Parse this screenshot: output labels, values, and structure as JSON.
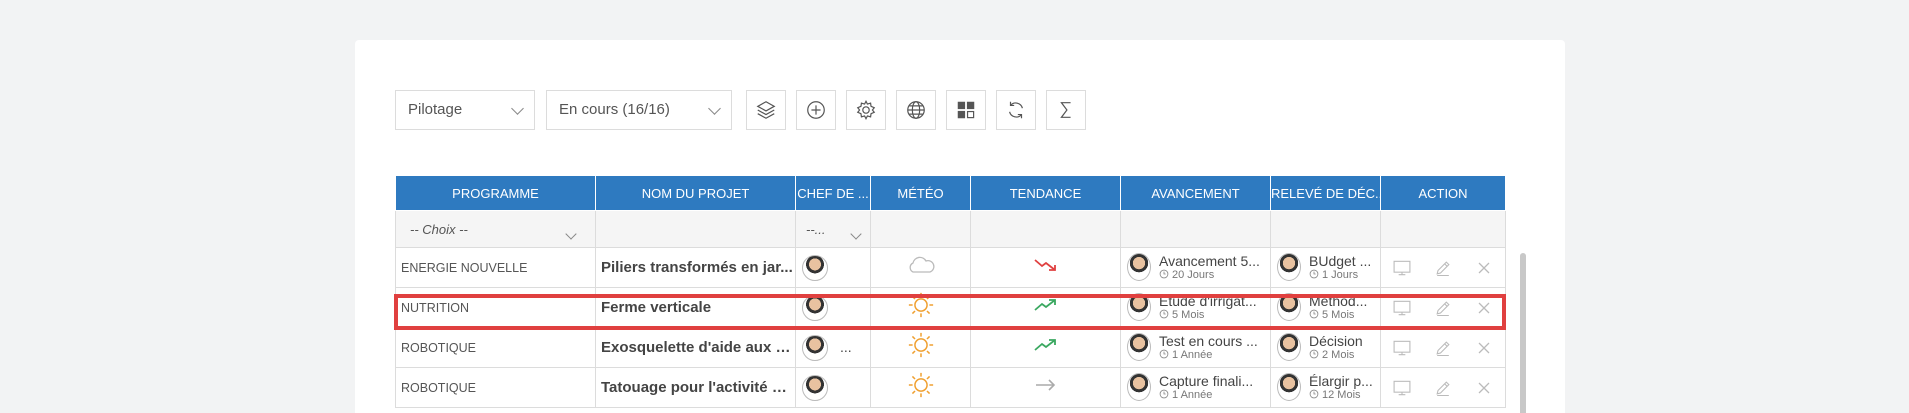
{
  "toolbar": {
    "view_select": "Pilotage",
    "status_select": "En cours (16/16)",
    "buttons": [
      "layers-icon",
      "add-icon",
      "settings-icon",
      "globe-icon",
      "dashboard-icon",
      "refresh-icon",
      "sum-icon"
    ]
  },
  "table": {
    "headers": [
      "PROGRAMME",
      "NOM DU PROJET",
      "CHEF DE ...",
      "MÉTÉO",
      "TENDANCE",
      "AVANCEMENT",
      "RELEVÉ DE DÉC...",
      "ACTION"
    ],
    "filter_programme": "-- Choix --",
    "filter_chef": "--...",
    "rows": [
      {
        "programme": "ENERGIE NOUVELLE",
        "projet": "Piliers transformés en jar...",
        "chef_extra": "",
        "meteo": "cloud-icon",
        "tendance": "trend-down-icon",
        "avancement": "Avancement 5...",
        "avancement_duree": "20 Jours",
        "releve": "BUdget ...",
        "releve_duree": "1 Jours"
      },
      {
        "programme": "NUTRITION",
        "projet": "Ferme verticale",
        "chef_extra": "",
        "meteo": "sun-icon",
        "tendance": "trend-up-icon",
        "avancement": "Etude d'irrigat...",
        "avancement_duree": "5 Mois",
        "releve": "Méthod...",
        "releve_duree": "5 Mois"
      },
      {
        "programme": "ROBOTIQUE",
        "projet": "Exosquelette d'aide aux a...",
        "chef_extra": "...",
        "meteo": "sun-icon",
        "tendance": "trend-up-icon",
        "avancement": "Test en cours ...",
        "avancement_duree": "1 Année",
        "releve": "Décision",
        "releve_duree": "2 Mois"
      },
      {
        "programme": "ROBOTIQUE",
        "projet": "Tatouage pour l'activité ca...",
        "chef_extra": "",
        "meteo": "sun-icon",
        "tendance": "trend-flat-icon",
        "avancement": "Capture finali...",
        "avancement_duree": "1 Année",
        "releve": "Élargir p...",
        "releve_duree": "12 Mois"
      }
    ]
  },
  "colors": {
    "header": "#2e7ac0",
    "highlight": "#e0403f",
    "sun": "#f0a030",
    "trend_down": "#e04040",
    "trend_up": "#3aa860"
  }
}
